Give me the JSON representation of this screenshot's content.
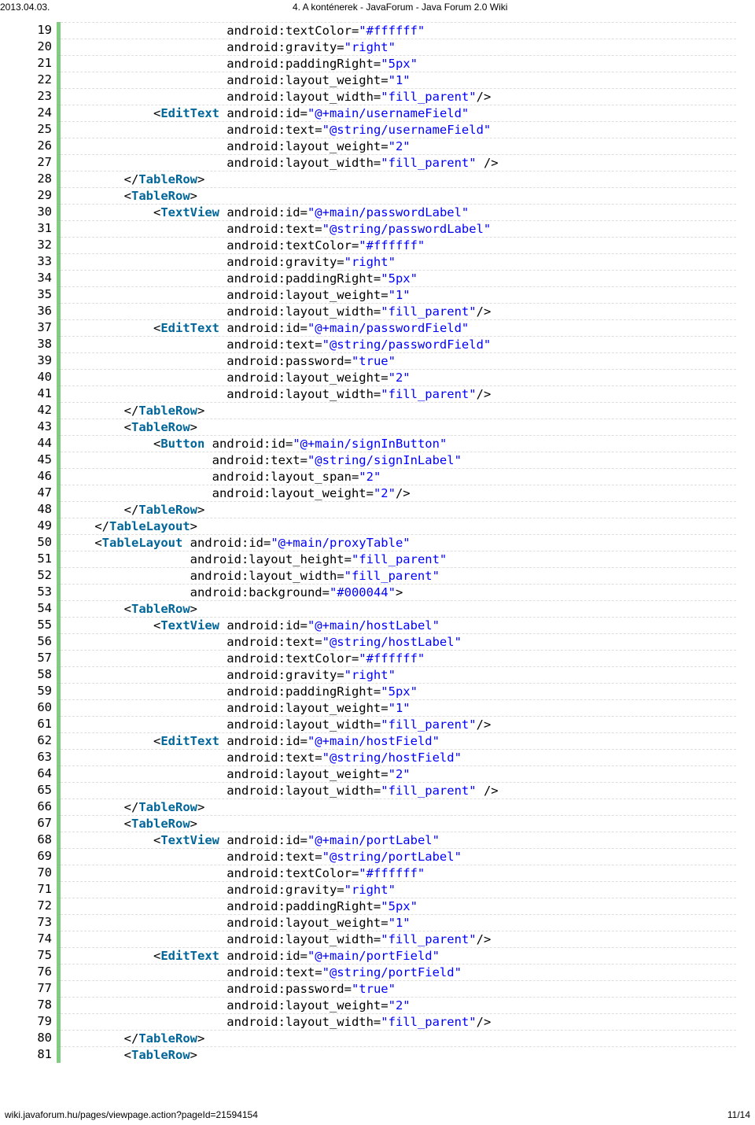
{
  "header": {
    "date": "2013.04.03.",
    "title": "4. A konténerek - JavaForum - Java Forum 2.0 Wiki"
  },
  "footer": {
    "url": "wiki.javaforum.hu/pages/viewpage.action?pageId=21594154",
    "page": "11/14"
  },
  "lines": [
    {
      "n": 19,
      "segs": [
        [
          "plain",
          "                      android:textColor="
        ],
        [
          "str",
          "\"#ffffff\""
        ]
      ]
    },
    {
      "n": 20,
      "segs": [
        [
          "plain",
          "                      android:gravity="
        ],
        [
          "str",
          "\"right\""
        ]
      ]
    },
    {
      "n": 21,
      "segs": [
        [
          "plain",
          "                      android:paddingRight="
        ],
        [
          "str",
          "\"5px\""
        ]
      ]
    },
    {
      "n": 22,
      "segs": [
        [
          "plain",
          "                      android:layout_weight="
        ],
        [
          "str",
          "\"1\""
        ]
      ]
    },
    {
      "n": 23,
      "segs": [
        [
          "plain",
          "                      android:layout_width="
        ],
        [
          "str",
          "\"fill_parent\""
        ],
        [
          "plain",
          "/>"
        ]
      ]
    },
    {
      "n": 24,
      "segs": [
        [
          "plain",
          "            <"
        ],
        [
          "elm",
          "EditText"
        ],
        [
          "plain",
          " android:id="
        ],
        [
          "str",
          "\"@+main/usernameField\""
        ]
      ]
    },
    {
      "n": 25,
      "segs": [
        [
          "plain",
          "                      android:text="
        ],
        [
          "str",
          "\"@string/usernameField\""
        ]
      ]
    },
    {
      "n": 26,
      "segs": [
        [
          "plain",
          "                      android:layout_weight="
        ],
        [
          "str",
          "\"2\""
        ]
      ]
    },
    {
      "n": 27,
      "segs": [
        [
          "plain",
          "                      android:layout_width="
        ],
        [
          "str",
          "\"fill_parent\""
        ],
        [
          "plain",
          " />"
        ]
      ]
    },
    {
      "n": 28,
      "segs": [
        [
          "plain",
          "        </"
        ],
        [
          "elm",
          "TableRow"
        ],
        [
          "plain",
          ">"
        ]
      ]
    },
    {
      "n": 29,
      "segs": [
        [
          "plain",
          "        <"
        ],
        [
          "elm",
          "TableRow"
        ],
        [
          "plain",
          ">"
        ]
      ]
    },
    {
      "n": 30,
      "segs": [
        [
          "plain",
          "            <"
        ],
        [
          "elm",
          "TextView"
        ],
        [
          "plain",
          " android:id="
        ],
        [
          "str",
          "\"@+main/passwordLabel\""
        ]
      ]
    },
    {
      "n": 31,
      "segs": [
        [
          "plain",
          "                      android:text="
        ],
        [
          "str",
          "\"@string/passwordLabel\""
        ]
      ]
    },
    {
      "n": 32,
      "segs": [
        [
          "plain",
          "                      android:textColor="
        ],
        [
          "str",
          "\"#ffffff\""
        ]
      ]
    },
    {
      "n": 33,
      "segs": [
        [
          "plain",
          "                      android:gravity="
        ],
        [
          "str",
          "\"right\""
        ]
      ]
    },
    {
      "n": 34,
      "segs": [
        [
          "plain",
          "                      android:paddingRight="
        ],
        [
          "str",
          "\"5px\""
        ]
      ]
    },
    {
      "n": 35,
      "segs": [
        [
          "plain",
          "                      android:layout_weight="
        ],
        [
          "str",
          "\"1\""
        ]
      ]
    },
    {
      "n": 36,
      "segs": [
        [
          "plain",
          "                      android:layout_width="
        ],
        [
          "str",
          "\"fill_parent\""
        ],
        [
          "plain",
          "/>"
        ]
      ]
    },
    {
      "n": 37,
      "segs": [
        [
          "plain",
          "            <"
        ],
        [
          "elm",
          "EditText"
        ],
        [
          "plain",
          " android:id="
        ],
        [
          "str",
          "\"@+main/passwordField\""
        ]
      ]
    },
    {
      "n": 38,
      "segs": [
        [
          "plain",
          "                      android:text="
        ],
        [
          "str",
          "\"@string/passwordField\""
        ]
      ]
    },
    {
      "n": 39,
      "segs": [
        [
          "plain",
          "                      android:password="
        ],
        [
          "str",
          "\"true\""
        ]
      ]
    },
    {
      "n": 40,
      "segs": [
        [
          "plain",
          "                      android:layout_weight="
        ],
        [
          "str",
          "\"2\""
        ]
      ]
    },
    {
      "n": 41,
      "segs": [
        [
          "plain",
          "                      android:layout_width="
        ],
        [
          "str",
          "\"fill_parent\""
        ],
        [
          "plain",
          "/>"
        ]
      ]
    },
    {
      "n": 42,
      "segs": [
        [
          "plain",
          "        </"
        ],
        [
          "elm",
          "TableRow"
        ],
        [
          "plain",
          ">"
        ]
      ]
    },
    {
      "n": 43,
      "segs": [
        [
          "plain",
          "        <"
        ],
        [
          "elm",
          "TableRow"
        ],
        [
          "plain",
          ">"
        ]
      ]
    },
    {
      "n": 44,
      "segs": [
        [
          "plain",
          "            <"
        ],
        [
          "elm",
          "Button"
        ],
        [
          "plain",
          " android:id="
        ],
        [
          "str",
          "\"@+main/signInButton\""
        ]
      ]
    },
    {
      "n": 45,
      "segs": [
        [
          "plain",
          "                    android:text="
        ],
        [
          "str",
          "\"@string/signInLabel\""
        ]
      ]
    },
    {
      "n": 46,
      "segs": [
        [
          "plain",
          "                    android:layout_span="
        ],
        [
          "str",
          "\"2\""
        ]
      ]
    },
    {
      "n": 47,
      "segs": [
        [
          "plain",
          "                    android:layout_weight="
        ],
        [
          "str",
          "\"2\""
        ],
        [
          "plain",
          "/>"
        ]
      ]
    },
    {
      "n": 48,
      "segs": [
        [
          "plain",
          "        </"
        ],
        [
          "elm",
          "TableRow"
        ],
        [
          "plain",
          ">"
        ]
      ]
    },
    {
      "n": 49,
      "segs": [
        [
          "plain",
          "    </"
        ],
        [
          "elm",
          "TableLayout"
        ],
        [
          "plain",
          ">"
        ]
      ]
    },
    {
      "n": 50,
      "segs": [
        [
          "plain",
          "    <"
        ],
        [
          "elm",
          "TableLayout"
        ],
        [
          "plain",
          " android:id="
        ],
        [
          "str",
          "\"@+main/proxyTable\""
        ]
      ]
    },
    {
      "n": 51,
      "segs": [
        [
          "plain",
          "                 android:layout_height="
        ],
        [
          "str",
          "\"fill_parent\""
        ]
      ]
    },
    {
      "n": 52,
      "segs": [
        [
          "plain",
          "                 android:layout_width="
        ],
        [
          "str",
          "\"fill_parent\""
        ]
      ]
    },
    {
      "n": 53,
      "segs": [
        [
          "plain",
          "                 android:background="
        ],
        [
          "str",
          "\"#000044\""
        ],
        [
          "plain",
          ">"
        ]
      ]
    },
    {
      "n": 54,
      "segs": [
        [
          "plain",
          "        <"
        ],
        [
          "elm",
          "TableRow"
        ],
        [
          "plain",
          ">"
        ]
      ]
    },
    {
      "n": 55,
      "segs": [
        [
          "plain",
          "            <"
        ],
        [
          "elm",
          "TextView"
        ],
        [
          "plain",
          " android:id="
        ],
        [
          "str",
          "\"@+main/hostLabel\""
        ]
      ]
    },
    {
      "n": 56,
      "segs": [
        [
          "plain",
          "                      android:text="
        ],
        [
          "str",
          "\"@string/hostLabel\""
        ]
      ]
    },
    {
      "n": 57,
      "segs": [
        [
          "plain",
          "                      android:textColor="
        ],
        [
          "str",
          "\"#ffffff\""
        ]
      ]
    },
    {
      "n": 58,
      "segs": [
        [
          "plain",
          "                      android:gravity="
        ],
        [
          "str",
          "\"right\""
        ]
      ]
    },
    {
      "n": 59,
      "segs": [
        [
          "plain",
          "                      android:paddingRight="
        ],
        [
          "str",
          "\"5px\""
        ]
      ]
    },
    {
      "n": 60,
      "segs": [
        [
          "plain",
          "                      android:layout_weight="
        ],
        [
          "str",
          "\"1\""
        ]
      ]
    },
    {
      "n": 61,
      "segs": [
        [
          "plain",
          "                      android:layout_width="
        ],
        [
          "str",
          "\"fill_parent\""
        ],
        [
          "plain",
          "/>"
        ]
      ]
    },
    {
      "n": 62,
      "segs": [
        [
          "plain",
          "            <"
        ],
        [
          "elm",
          "EditText"
        ],
        [
          "plain",
          " android:id="
        ],
        [
          "str",
          "\"@+main/hostField\""
        ]
      ]
    },
    {
      "n": 63,
      "segs": [
        [
          "plain",
          "                      android:text="
        ],
        [
          "str",
          "\"@string/hostField\""
        ]
      ]
    },
    {
      "n": 64,
      "segs": [
        [
          "plain",
          "                      android:layout_weight="
        ],
        [
          "str",
          "\"2\""
        ]
      ]
    },
    {
      "n": 65,
      "segs": [
        [
          "plain",
          "                      android:layout_width="
        ],
        [
          "str",
          "\"fill_parent\""
        ],
        [
          "plain",
          " />"
        ]
      ]
    },
    {
      "n": 66,
      "segs": [
        [
          "plain",
          "        </"
        ],
        [
          "elm",
          "TableRow"
        ],
        [
          "plain",
          ">"
        ]
      ]
    },
    {
      "n": 67,
      "segs": [
        [
          "plain",
          "        <"
        ],
        [
          "elm",
          "TableRow"
        ],
        [
          "plain",
          ">"
        ]
      ]
    },
    {
      "n": 68,
      "segs": [
        [
          "plain",
          "            <"
        ],
        [
          "elm",
          "TextView"
        ],
        [
          "plain",
          " android:id="
        ],
        [
          "str",
          "\"@+main/portLabel\""
        ]
      ]
    },
    {
      "n": 69,
      "segs": [
        [
          "plain",
          "                      android:text="
        ],
        [
          "str",
          "\"@string/portLabel\""
        ]
      ]
    },
    {
      "n": 70,
      "segs": [
        [
          "plain",
          "                      android:textColor="
        ],
        [
          "str",
          "\"#ffffff\""
        ]
      ]
    },
    {
      "n": 71,
      "segs": [
        [
          "plain",
          "                      android:gravity="
        ],
        [
          "str",
          "\"right\""
        ]
      ]
    },
    {
      "n": 72,
      "segs": [
        [
          "plain",
          "                      android:paddingRight="
        ],
        [
          "str",
          "\"5px\""
        ]
      ]
    },
    {
      "n": 73,
      "segs": [
        [
          "plain",
          "                      android:layout_weight="
        ],
        [
          "str",
          "\"1\""
        ]
      ]
    },
    {
      "n": 74,
      "segs": [
        [
          "plain",
          "                      android:layout_width="
        ],
        [
          "str",
          "\"fill_parent\""
        ],
        [
          "plain",
          "/>"
        ]
      ]
    },
    {
      "n": 75,
      "segs": [
        [
          "plain",
          "            <"
        ],
        [
          "elm",
          "EditText"
        ],
        [
          "plain",
          " android:id="
        ],
        [
          "str",
          "\"@+main/portField\""
        ]
      ]
    },
    {
      "n": 76,
      "segs": [
        [
          "plain",
          "                      android:text="
        ],
        [
          "str",
          "\"@string/portField\""
        ]
      ]
    },
    {
      "n": 77,
      "segs": [
        [
          "plain",
          "                      android:password="
        ],
        [
          "str",
          "\"true\""
        ]
      ]
    },
    {
      "n": 78,
      "segs": [
        [
          "plain",
          "                      android:layout_weight="
        ],
        [
          "str",
          "\"2\""
        ]
      ]
    },
    {
      "n": 79,
      "segs": [
        [
          "plain",
          "                      android:layout_width="
        ],
        [
          "str",
          "\"fill_parent\""
        ],
        [
          "plain",
          "/>"
        ]
      ]
    },
    {
      "n": 80,
      "segs": [
        [
          "plain",
          "        </"
        ],
        [
          "elm",
          "TableRow"
        ],
        [
          "plain",
          ">"
        ]
      ]
    },
    {
      "n": 81,
      "segs": [
        [
          "plain",
          "        <"
        ],
        [
          "elm",
          "TableRow"
        ],
        [
          "plain",
          ">"
        ]
      ]
    }
  ]
}
